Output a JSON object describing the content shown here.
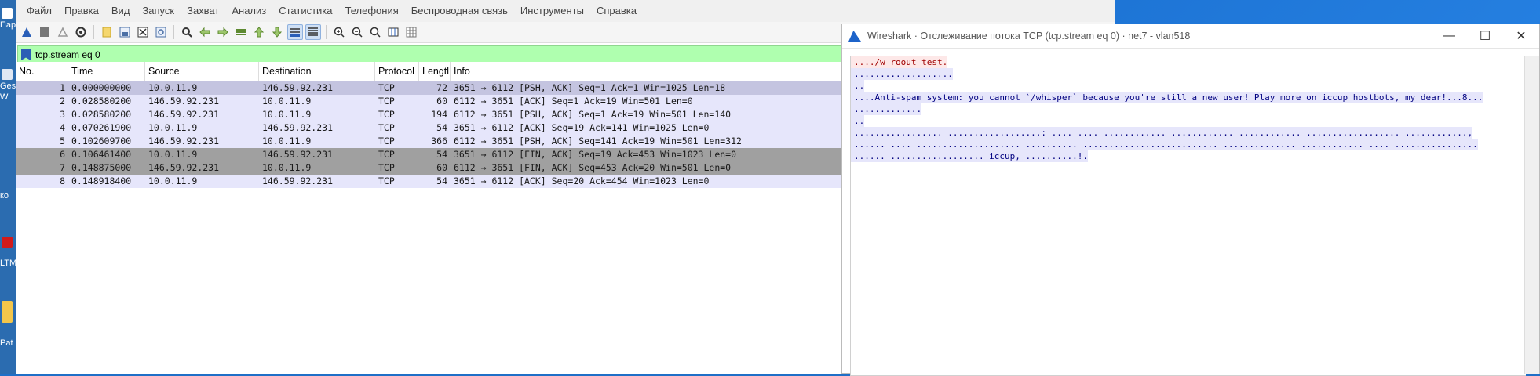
{
  "desktop": {
    "labels": [
      "Пар",
      "Gest",
      "W",
      "ко",
      "LTM",
      "Pat"
    ]
  },
  "menubar": {
    "items": [
      "Файл",
      "Правка",
      "Вид",
      "Запуск",
      "Захват",
      "Анализ",
      "Статистика",
      "Телефония",
      "Беспроводная связь",
      "Инструменты",
      "Справка"
    ]
  },
  "toolbar": {
    "icons": [
      "start-capture-icon",
      "stop-capture-icon",
      "restart-capture-icon",
      "capture-options-icon",
      "open-file-icon",
      "save-file-icon",
      "close-file-icon",
      "reload-icon",
      "find-packet-icon",
      "go-back-icon",
      "go-forward-icon",
      "go-to-packet-icon",
      "first-packet-icon",
      "last-packet-icon",
      "auto-scroll-icon",
      "colorize-icon",
      "zoom-in-icon",
      "zoom-out-icon",
      "normal-size-icon",
      "resize-columns-icon",
      "grid-icon"
    ]
  },
  "filter": {
    "value": "tcp.stream eq 0",
    "color": "#afffaf"
  },
  "packets": {
    "columns": [
      "No.",
      "Time",
      "Source",
      "Destination",
      "Protocol",
      "Lengtl",
      "Info"
    ],
    "rows": [
      {
        "no": "1",
        "time": "0.000000000",
        "src": "10.0.11.9",
        "dst": "146.59.92.231",
        "proto": "TCP",
        "len": "72",
        "info": "3651 → 6112 [PSH, ACK] Seq=1 Ack=1 Win=1025 Len=18",
        "style": "sel"
      },
      {
        "no": "2",
        "time": "0.028580200",
        "src": "146.59.92.231",
        "dst": "10.0.11.9",
        "proto": "TCP",
        "len": "60",
        "info": "6112 → 3651 [ACK] Seq=1 Ack=19 Win=501 Len=0",
        "style": "normal"
      },
      {
        "no": "3",
        "time": "0.028580200",
        "src": "146.59.92.231",
        "dst": "10.0.11.9",
        "proto": "TCP",
        "len": "194",
        "info": "6112 → 3651 [PSH, ACK] Seq=1 Ack=19 Win=501 Len=140",
        "style": "normal"
      },
      {
        "no": "4",
        "time": "0.070261900",
        "src": "10.0.11.9",
        "dst": "146.59.92.231",
        "proto": "TCP",
        "len": "54",
        "info": "3651 → 6112 [ACK] Seq=19 Ack=141 Win=1025 Len=0",
        "style": "normal"
      },
      {
        "no": "5",
        "time": "0.102609700",
        "src": "146.59.92.231",
        "dst": "10.0.11.9",
        "proto": "TCP",
        "len": "366",
        "info": "6112 → 3651 [PSH, ACK] Seq=141 Ack=19 Win=501 Len=312",
        "style": "normal"
      },
      {
        "no": "6",
        "time": "0.106461400",
        "src": "10.0.11.9",
        "dst": "146.59.92.231",
        "proto": "TCP",
        "len": "54",
        "info": "3651 → 6112 [FIN, ACK] Seq=19 Ack=453 Win=1023 Len=0",
        "style": "fin"
      },
      {
        "no": "7",
        "time": "0.148875000",
        "src": "146.59.92.231",
        "dst": "10.0.11.9",
        "proto": "TCP",
        "len": "60",
        "info": "6112 → 3651 [FIN, ACK] Seq=453 Ack=20 Win=501 Len=0",
        "style": "fin"
      },
      {
        "no": "8",
        "time": "0.148918400",
        "src": "10.0.11.9",
        "dst": "146.59.92.231",
        "proto": "TCP",
        "len": "54",
        "info": "3651 → 6112 [ACK] Seq=20 Ack=454 Win=1023 Len=0",
        "style": "normal"
      }
    ]
  },
  "stream_window": {
    "title": "Wireshark · Отслеживание потока TCP (tcp.stream eq 0) · net7 - vlan518",
    "minimize": "—",
    "maximize": "☐",
    "close": "✕",
    "lines": [
      {
        "text": "..../w roout test.",
        "side": "client"
      },
      {
        "text": "...................",
        "side": "server"
      },
      {
        "text": "..",
        "side": "server"
      },
      {
        "text": "....Anti-spam system: you cannot `/whisper` because you're still a new user! Play more on iccup hostbots, my dear!...8...",
        "side": "server"
      },
      {
        "text": ".............",
        "side": "server"
      },
      {
        "text": "..",
        "side": "server"
      },
      {
        "text": "................. ..................: .... .... ............ ............ ............ .................. ............,",
        "side": "server"
      },
      {
        "text": "...... .... .................... .......... .......................... .............. ............ .... ................",
        "side": "server"
      },
      {
        "text": "...... .................. iccup, ..........!.",
        "side": "server"
      }
    ]
  }
}
